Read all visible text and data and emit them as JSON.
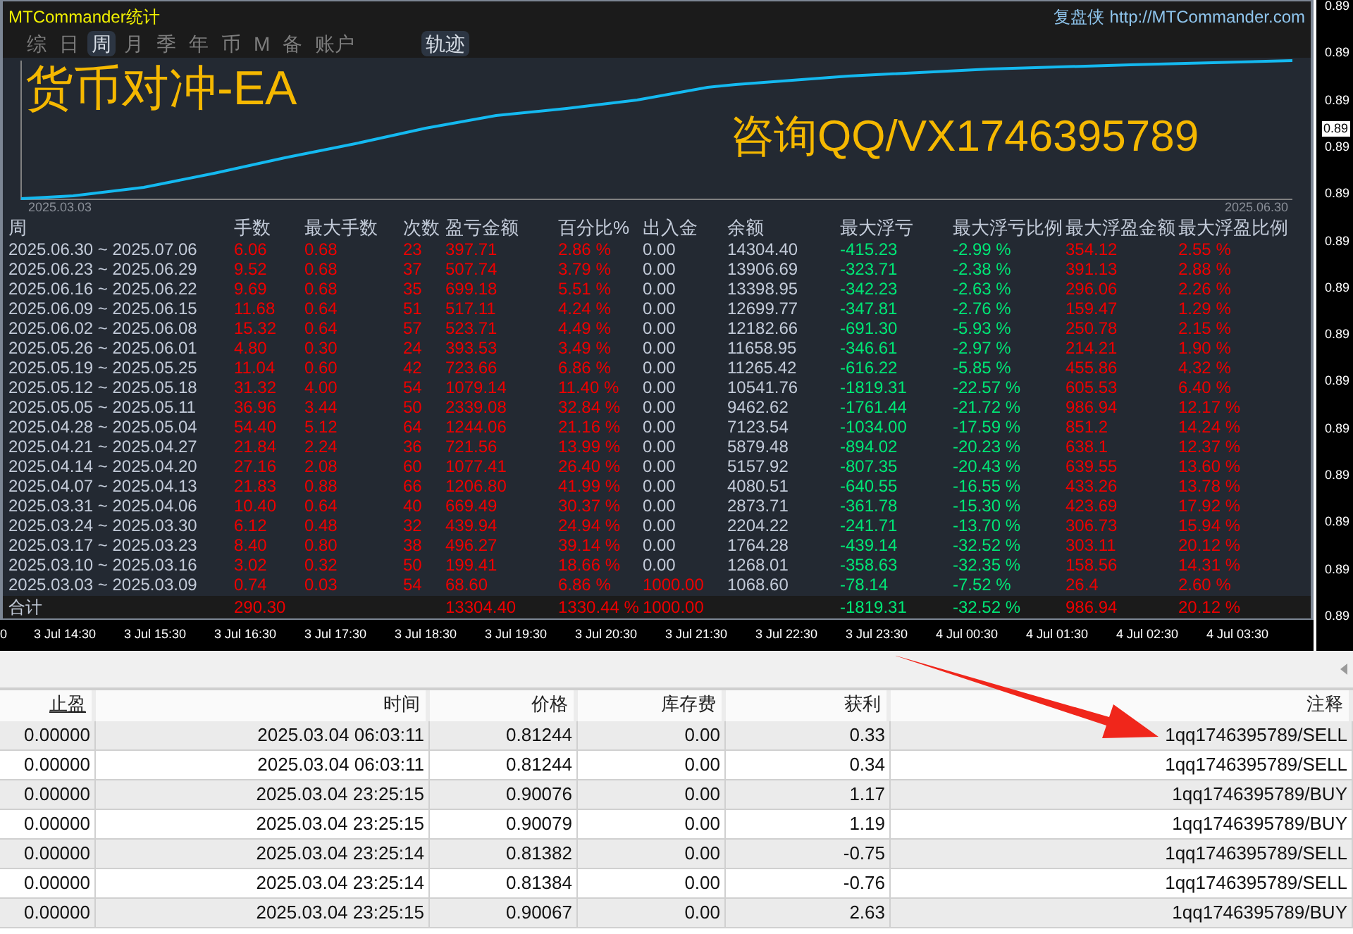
{
  "window": {
    "title": "MTCommander统计",
    "brand": "复盘侠",
    "url": "http://MTCommander.com"
  },
  "period_tabs": [
    {
      "label": "综",
      "selected": false
    },
    {
      "label": "日",
      "selected": false
    },
    {
      "label": "周",
      "selected": true
    },
    {
      "label": "月",
      "selected": false
    },
    {
      "label": "季",
      "selected": false
    },
    {
      "label": "年",
      "selected": false
    },
    {
      "label": "币",
      "selected": false
    },
    {
      "label": "M",
      "selected": false
    },
    {
      "label": "备",
      "selected": false
    },
    {
      "label": "账户",
      "selected": false
    }
  ],
  "view_tabs": [
    {
      "label": "轨迹",
      "selected": true
    }
  ],
  "equity_chart": {
    "overlay_title": "货币对冲-EA",
    "overlay_contact": "咨询QQ/VX1746395789",
    "start_label": "2025.03.03",
    "end_label": "2025.06.30"
  },
  "weekly_table": {
    "columns": [
      {
        "label": "周",
        "kind": "date"
      },
      {
        "label": "手数",
        "kind": "loss"
      },
      {
        "label": "最大手数",
        "kind": "loss"
      },
      {
        "label": "次数",
        "kind": "loss"
      },
      {
        "label": "盈亏金额",
        "kind": "loss"
      },
      {
        "label": "百分比%",
        "kind": "loss"
      },
      {
        "label": "出入金",
        "kind": "flow"
      },
      {
        "label": "余额",
        "kind": "date"
      },
      {
        "label": "最大浮亏",
        "kind": "gain"
      },
      {
        "label": "最大浮亏比例",
        "kind": "gain"
      },
      {
        "label": "最大浮盈金额",
        "kind": "loss"
      },
      {
        "label": "最大浮盈比例",
        "kind": "loss"
      }
    ],
    "rows": [
      {
        "cells": [
          "2025.06.30 ~ 2025.07.06",
          "6.06",
          "0.68",
          "23",
          "397.71",
          "2.86 %",
          "0.00",
          "14304.40",
          "-415.23",
          "-2.99 %",
          "354.12",
          "2.55 %"
        ],
        "flow_highlighted": false
      },
      {
        "cells": [
          "2025.06.23 ~ 2025.06.29",
          "9.52",
          "0.68",
          "37",
          "507.74",
          "3.79 %",
          "0.00",
          "13906.69",
          "-323.71",
          "-2.38 %",
          "391.13",
          "2.88 %"
        ],
        "flow_highlighted": false
      },
      {
        "cells": [
          "2025.06.16 ~ 2025.06.22",
          "9.69",
          "0.68",
          "35",
          "699.18",
          "5.51 %",
          "0.00",
          "13398.95",
          "-342.23",
          "-2.63 %",
          "296.06",
          "2.26 %"
        ],
        "flow_highlighted": false
      },
      {
        "cells": [
          "2025.06.09 ~ 2025.06.15",
          "11.68",
          "0.64",
          "51",
          "517.11",
          "4.24 %",
          "0.00",
          "12699.77",
          "-347.81",
          "-2.76 %",
          "159.47",
          "1.29 %"
        ],
        "flow_highlighted": false
      },
      {
        "cells": [
          "2025.06.02 ~ 2025.06.08",
          "15.32",
          "0.64",
          "57",
          "523.71",
          "4.49 %",
          "0.00",
          "12182.66",
          "-691.30",
          "-5.93 %",
          "250.78",
          "2.15 %"
        ],
        "flow_highlighted": false
      },
      {
        "cells": [
          "2025.05.26 ~ 2025.06.01",
          "4.80",
          "0.30",
          "24",
          "393.53",
          "3.49 %",
          "0.00",
          "11658.95",
          "-346.61",
          "-2.97 %",
          "214.21",
          "1.90 %"
        ],
        "flow_highlighted": false
      },
      {
        "cells": [
          "2025.05.19 ~ 2025.05.25",
          "11.04",
          "0.60",
          "42",
          "723.66",
          "6.86 %",
          "0.00",
          "11265.42",
          "-616.22",
          "-5.85 %",
          "455.86",
          "4.32 %"
        ],
        "flow_highlighted": false
      },
      {
        "cells": [
          "2025.05.12 ~ 2025.05.18",
          "31.32",
          "4.00",
          "54",
          "1079.14",
          "11.40 %",
          "0.00",
          "10541.76",
          "-1819.31",
          "-22.57 %",
          "605.53",
          "6.40 %"
        ],
        "flow_highlighted": false
      },
      {
        "cells": [
          "2025.05.05 ~ 2025.05.11",
          "36.96",
          "3.44",
          "50",
          "2339.08",
          "32.84 %",
          "0.00",
          "9462.62",
          "-1761.44",
          "-21.72 %",
          "986.94",
          "12.17 %"
        ],
        "flow_highlighted": false
      },
      {
        "cells": [
          "2025.04.28 ~ 2025.05.04",
          "54.40",
          "5.12",
          "64",
          "1244.06",
          "21.16 %",
          "0.00",
          "7123.54",
          "-1034.00",
          "-17.59 %",
          "851.2",
          "14.24 %"
        ],
        "flow_highlighted": false
      },
      {
        "cells": [
          "2025.04.21 ~ 2025.04.27",
          "21.84",
          "2.24",
          "36",
          "721.56",
          "13.99 %",
          "0.00",
          "5879.48",
          "-894.02",
          "-20.23 %",
          "638.1",
          "12.37 %"
        ],
        "flow_highlighted": false
      },
      {
        "cells": [
          "2025.04.14 ~ 2025.04.20",
          "27.16",
          "2.08",
          "60",
          "1077.41",
          "26.40 %",
          "0.00",
          "5157.92",
          "-807.35",
          "-20.43 %",
          "639.55",
          "13.60 %"
        ],
        "flow_highlighted": false
      },
      {
        "cells": [
          "2025.04.07 ~ 2025.04.13",
          "21.83",
          "0.88",
          "66",
          "1206.80",
          "41.99 %",
          "0.00",
          "4080.51",
          "-640.55",
          "-16.55 %",
          "433.26",
          "13.78 %"
        ],
        "flow_highlighted": false
      },
      {
        "cells": [
          "2025.03.31 ~ 2025.04.06",
          "10.40",
          "0.64",
          "40",
          "669.49",
          "30.37 %",
          "0.00",
          "2873.71",
          "-361.78",
          "-15.30 %",
          "423.69",
          "17.92 %"
        ],
        "flow_highlighted": false
      },
      {
        "cells": [
          "2025.03.24 ~ 2025.03.30",
          "6.12",
          "0.48",
          "32",
          "439.94",
          "24.94 %",
          "0.00",
          "2204.22",
          "-241.71",
          "-13.70 %",
          "306.73",
          "15.94 %"
        ],
        "flow_highlighted": false
      },
      {
        "cells": [
          "2025.03.17 ~ 2025.03.23",
          "8.40",
          "0.80",
          "38",
          "496.27",
          "39.14 %",
          "0.00",
          "1764.28",
          "-439.14",
          "-32.52 %",
          "303.11",
          "20.12 %"
        ],
        "flow_highlighted": false
      },
      {
        "cells": [
          "2025.03.10 ~ 2025.03.16",
          "3.02",
          "0.32",
          "50",
          "199.41",
          "18.66 %",
          "0.00",
          "1268.01",
          "-358.63",
          "-32.35 %",
          "158.56",
          "14.31 %"
        ],
        "flow_highlighted": false
      },
      {
        "cells": [
          "2025.03.03 ~ 2025.03.09",
          "0.74",
          "0.03",
          "54",
          "68.60",
          "6.86 %",
          "1000.00",
          "1068.60",
          "-78.14",
          "-7.52 %",
          "26.4",
          "2.60 %"
        ],
        "flow_highlighted": true
      }
    ],
    "total": {
      "cells": [
        "合计",
        "290.30",
        "",
        "",
        "13304.40",
        "1330.44 %",
        "1000.00",
        "",
        "-1819.31",
        "-32.52 %",
        "986.94",
        "20.12 %"
      ],
      "flow_highlighted": true
    }
  },
  "price_axis": [
    {
      "label": "0.89",
      "current": false
    },
    {
      "label": "0.89",
      "current": false
    },
    {
      "label": "0.89",
      "current": false
    },
    {
      "label": "0.89",
      "current": true
    },
    {
      "label": "0.89",
      "current": false
    },
    {
      "label": "0.89",
      "current": false
    },
    {
      "label": "0.89",
      "current": false
    },
    {
      "label": "0.89",
      "current": false
    },
    {
      "label": "0.89",
      "current": false
    },
    {
      "label": "0.89",
      "current": false
    },
    {
      "label": "0.89",
      "current": false
    },
    {
      "label": "0.89",
      "current": false
    },
    {
      "label": "0.89",
      "current": false
    },
    {
      "label": "0.89",
      "current": false
    },
    {
      "label": "0.89",
      "current": false
    }
  ],
  "time_axis": [
    "0",
    "3 Jul 14:30",
    "3 Jul 15:30",
    "3 Jul 16:30",
    "3 Jul 17:30",
    "3 Jul 18:30",
    "3 Jul 19:30",
    "3 Jul 20:30",
    "3 Jul 21:30",
    "3 Jul 22:30",
    "3 Jul 23:30",
    "4 Jul 00:30",
    "4 Jul 01:30",
    "4 Jul 02:30",
    "4 Jul 03:30"
  ],
  "orders_table": {
    "columns": [
      {
        "label": "止盈",
        "sorted": true
      },
      {
        "label": "时间",
        "sorted": false
      },
      {
        "label": "价格",
        "sorted": false
      },
      {
        "label": "库存费",
        "sorted": false
      },
      {
        "label": "获利",
        "sorted": false
      },
      {
        "label": "注释",
        "sorted": false
      }
    ],
    "rows": [
      [
        "0.00000",
        "2025.03.04 06:03:11",
        "0.81244",
        "0.00",
        "0.33",
        "1qq1746395789/SELL"
      ],
      [
        "0.00000",
        "2025.03.04 06:03:11",
        "0.81244",
        "0.00",
        "0.34",
        "1qq1746395789/SELL"
      ],
      [
        "0.00000",
        "2025.03.04 23:25:15",
        "0.90076",
        "0.00",
        "1.17",
        "1qq1746395789/BUY"
      ],
      [
        "0.00000",
        "2025.03.04 23:25:15",
        "0.90079",
        "0.00",
        "1.19",
        "1qq1746395789/BUY"
      ],
      [
        "0.00000",
        "2025.03.04 23:25:14",
        "0.81382",
        "0.00",
        "-0.75",
        "1qq1746395789/SELL"
      ],
      [
        "0.00000",
        "2025.03.04 23:25:14",
        "0.81384",
        "0.00",
        "-0.76",
        "1qq1746395789/SELL"
      ],
      [
        "0.00000",
        "2025.03.04 23:25:15",
        "0.90067",
        "0.00",
        "2.63",
        "1qq1746395789/BUY"
      ]
    ]
  }
}
